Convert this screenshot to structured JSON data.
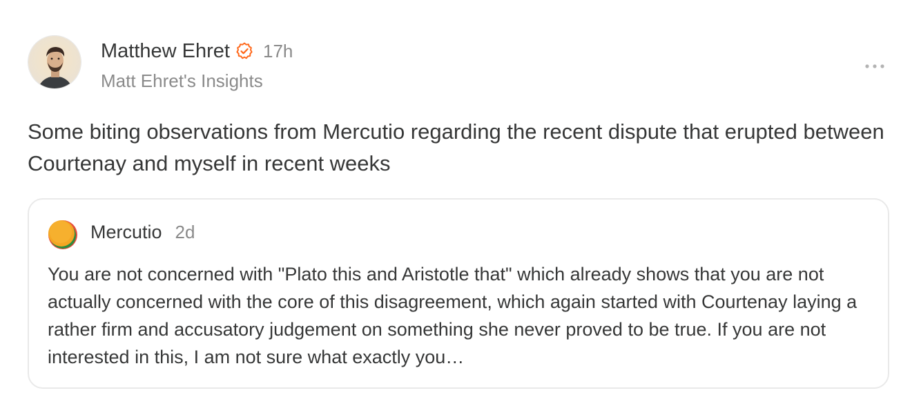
{
  "post": {
    "author": "Matthew Ehret",
    "time": "17h",
    "publication": "Matt Ehret's Insights",
    "body": "Some biting observations from Mercutio regarding the recent dispute that erupted between Courtenay and myself in recent weeks",
    "verified_color": "#ff6719"
  },
  "quote": {
    "author": "Mercutio",
    "time": "2d",
    "text": "You are not concerned with \"Plato this and Aristotle that\" which already shows that you are not actually concerned with the core of this disagreement, which again started with Courtenay laying a rather firm and accusatory judgement on something she never proved to be true. If you are not interested in this, I am not sure what exactly you…"
  },
  "icons": {
    "verified": "verified-check-icon",
    "more": "more-horizontal-icon"
  }
}
